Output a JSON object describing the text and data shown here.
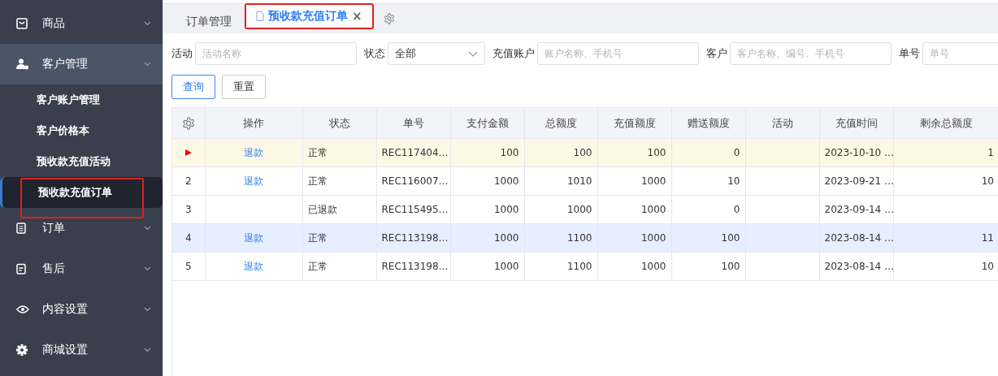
{
  "sidebar": {
    "items": [
      {
        "label": "商品",
        "expanded": false
      },
      {
        "label": "客户管理",
        "expanded": true,
        "children": [
          {
            "label": "客户账户管理",
            "selected": false
          },
          {
            "label": "客户价格本",
            "selected": false
          },
          {
            "label": "预收款充值活动",
            "selected": false
          },
          {
            "label": "预收款充值订单",
            "selected": true
          }
        ]
      },
      {
        "label": "订单",
        "expanded": false
      },
      {
        "label": "售后",
        "expanded": false
      },
      {
        "label": "内容设置",
        "expanded": false
      },
      {
        "label": "商城设置",
        "expanded": false
      }
    ]
  },
  "tabs": [
    {
      "label": "订单管理",
      "selected": false
    },
    {
      "label": "预收款充值订单",
      "selected": true,
      "close": "×"
    }
  ],
  "filters": [
    {
      "label": "活动",
      "kind": "input",
      "placeholder": "活动名称"
    },
    {
      "label": "状态",
      "kind": "select",
      "value": "全部"
    },
    {
      "label": "充值账户",
      "kind": "input",
      "placeholder": "账户名称、手机号"
    },
    {
      "label": "客户",
      "kind": "input",
      "placeholder": "客户名称、编号、手机号"
    },
    {
      "label": "单号",
      "kind": "input",
      "placeholder": "单号"
    }
  ],
  "buttons": [
    {
      "label": "查询",
      "kind": "primary"
    },
    {
      "label": "重置",
      "kind": "default"
    }
  ],
  "table": {
    "columns": [
      "操作",
      "状态",
      "单号",
      "支付金额",
      "总额度",
      "充值额度",
      "赠送额度",
      "活动",
      "充值时间",
      "剩余总额度"
    ],
    "rows": [
      {
        "current": true,
        "selected": false,
        "cells": [
          "退款",
          "正常",
          "REC117404…",
          "100",
          "100",
          "100",
          "0",
          "",
          "2023-10-10 …",
          "1"
        ]
      },
      {
        "index": "2",
        "current": false,
        "selected": false,
        "cells": [
          "退款",
          "正常",
          "REC116007…",
          "1000",
          "1010",
          "1000",
          "10",
          "",
          "2023-09-21 …",
          "10"
        ]
      },
      {
        "index": "3",
        "current": false,
        "selected": false,
        "cells": [
          "",
          "已退款",
          "REC115495…",
          "1000",
          "1000",
          "1000",
          "0",
          "",
          "2023-09-14 …",
          ""
        ]
      },
      {
        "index": "4",
        "current": false,
        "selected": true,
        "cells": [
          "退款",
          "正常",
          "REC113198…",
          "1000",
          "1100",
          "1000",
          "100",
          "",
          "2023-08-14 …",
          "11"
        ]
      },
      {
        "index": "5",
        "current": false,
        "selected": false,
        "cells": [
          "退款",
          "正常",
          "REC113198…",
          "1000",
          "1100",
          "1000",
          "100",
          "",
          "2023-08-14 …",
          "10"
        ]
      }
    ]
  }
}
